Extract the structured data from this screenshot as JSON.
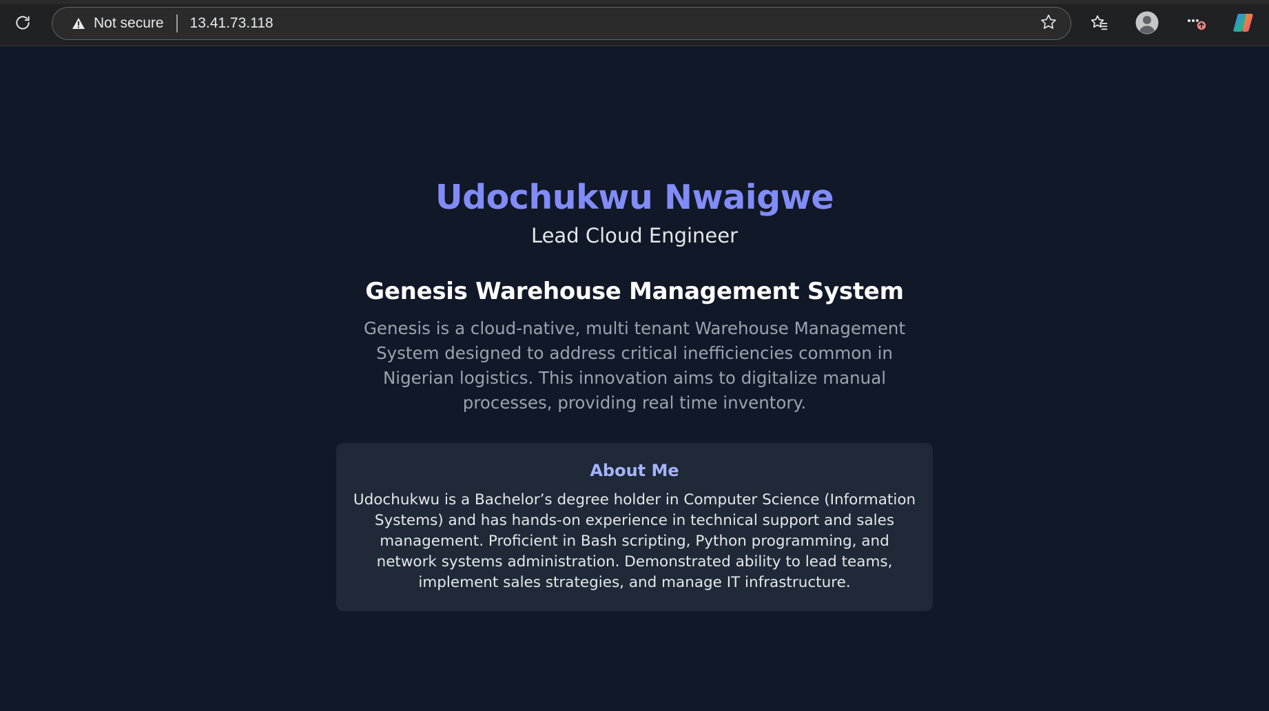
{
  "browser": {
    "security_label": "Not secure",
    "url": "13.41.73.118",
    "icons": {
      "reload": "reload-icon",
      "warning": "warning-triangle-icon",
      "favorite": "star-icon",
      "favorites_bar": "favorites-icon",
      "profile": "profile-icon",
      "more": "more-icon",
      "copilot": "copilot-icon"
    }
  },
  "page": {
    "name": "Udochukwu Nwaigwe",
    "role": "Lead Cloud Engineer",
    "project": {
      "title": "Genesis Warehouse Management System",
      "description": "Genesis is a cloud-native, multi tenant Warehouse Management System designed to address critical inefficiencies common in Nigerian logistics. This innovation aims to digitalize manual processes, providing real time inventory."
    },
    "about": {
      "title": "About Me",
      "text": "Udochukwu is a Bachelor’s degree holder in Computer Science (Information Systems) and has hands-on experience in technical support and sales management. Proficient in Bash scripting, Python programming, and network systems administration. Demonstrated ability to lead teams, implement sales strategies, and manage IT infrastructure."
    }
  },
  "colors": {
    "background": "#111827",
    "accent_name": "#818cf8",
    "card_background": "#1f2937",
    "card_title": "#a5b4fc",
    "muted_text": "#9ca3af"
  }
}
